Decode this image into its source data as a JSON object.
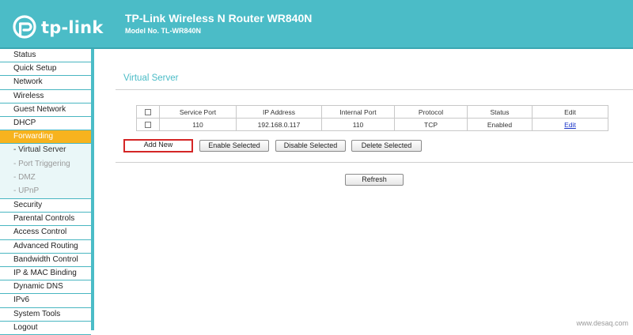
{
  "header": {
    "brand": "tp-link",
    "title": "TP-Link Wireless N Router WR840N",
    "model": "Model No. TL-WR840N"
  },
  "sidebar": {
    "items": [
      {
        "label": "Status"
      },
      {
        "label": "Quick Setup"
      },
      {
        "label": "Network"
      },
      {
        "label": "Wireless"
      },
      {
        "label": "Guest Network"
      },
      {
        "label": "DHCP"
      },
      {
        "label": "Forwarding",
        "active": true
      },
      {
        "label": "- Virtual Server"
      },
      {
        "label": "- Port Triggering"
      },
      {
        "label": "- DMZ"
      },
      {
        "label": "- UPnP"
      },
      {
        "label": "Security"
      },
      {
        "label": "Parental Controls"
      },
      {
        "label": "Access Control"
      },
      {
        "label": "Advanced Routing"
      },
      {
        "label": "Bandwidth Control"
      },
      {
        "label": "IP & MAC Binding"
      },
      {
        "label": "Dynamic DNS"
      },
      {
        "label": "IPv6"
      },
      {
        "label": "System Tools"
      },
      {
        "label": "Logout"
      }
    ]
  },
  "main": {
    "page_title": "Virtual Server",
    "table": {
      "headers": [
        "Service Port",
        "IP Address",
        "Internal Port",
        "Protocol",
        "Status",
        "Edit"
      ],
      "rows": [
        {
          "service_port": "110",
          "ip_address": "192.168.0.117",
          "internal_port": "110",
          "protocol": "TCP",
          "status": "Enabled",
          "edit": "Edit"
        }
      ]
    },
    "buttons": {
      "add_new": "Add New",
      "enable_selected": "Enable Selected",
      "disable_selected": "Disable Selected",
      "delete_selected": "Delete Selected",
      "refresh": "Refresh"
    }
  },
  "watermark": "www.desaq.com",
  "colors": {
    "header_bg": "#4bbcc7",
    "active_menu": "#f7b31e",
    "highlight_border": "#d42626",
    "link": "#1a35c9"
  },
  "icons": {
    "logo": "tp-link-logo-icon"
  }
}
